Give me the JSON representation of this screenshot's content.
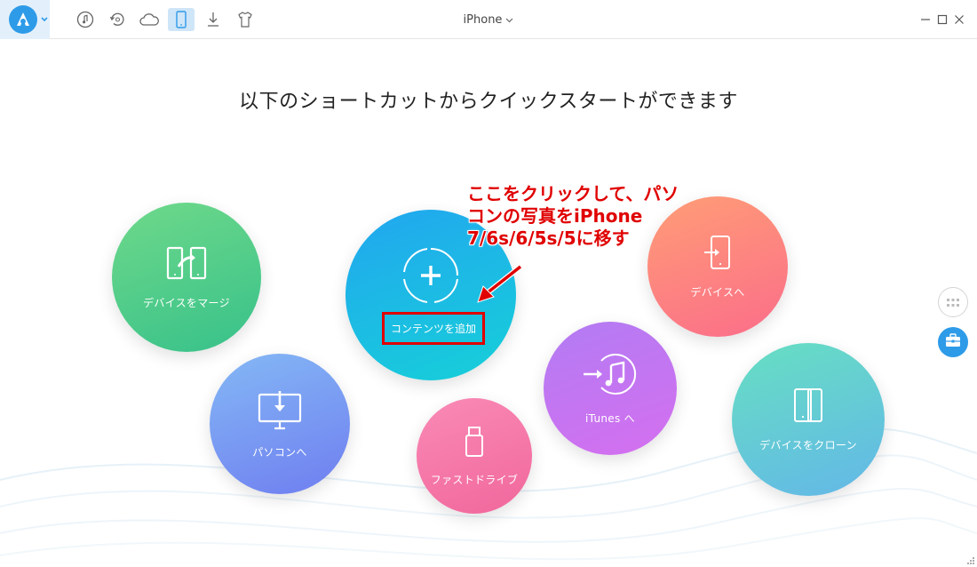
{
  "app": {
    "device_name": "iPhone",
    "headline": "以下のショートカットからクイックスタートができます"
  },
  "toolbar": {
    "icons": [
      "music-icon",
      "backup-icon",
      "cloud-icon",
      "device-icon",
      "download-icon",
      "tshirt-icon"
    ],
    "active": "device-icon"
  },
  "shortcuts": {
    "merge": "デバイスをマージ",
    "to_pc": "パソコンへ",
    "add_content": "コンテンツを追加",
    "flash_drive": "ファストドライブ",
    "itunes": "iTunes へ",
    "to_device": "デバイスへ",
    "clone": "デバイスをクローン"
  },
  "annotation": {
    "line1": "ここをクリックして、パソ",
    "line2": "コンの写真をiPhone",
    "line3": "7/6s/6/5s/5に移す"
  },
  "colors": {
    "accent": "#2e9be8",
    "annotation_red": "#e00000"
  }
}
